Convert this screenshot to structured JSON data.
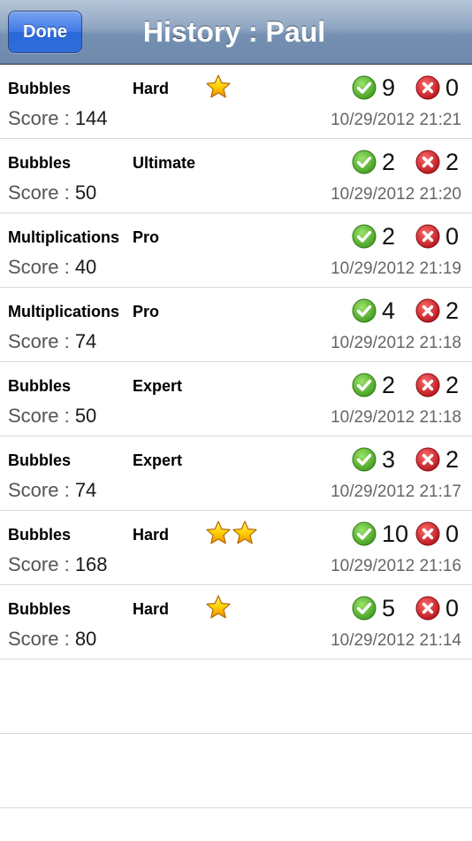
{
  "nav": {
    "done_label": "Done",
    "title": "History : Paul"
  },
  "score_prefix": "Score : ",
  "rows": [
    {
      "game": "Bubbles",
      "level": "Hard",
      "stars": 1,
      "score": "144",
      "correct": "9",
      "wrong": "0",
      "timestamp": "10/29/2012 21:21"
    },
    {
      "game": "Bubbles",
      "level": "Ultimate",
      "stars": 0,
      "score": "50",
      "correct": "2",
      "wrong": "2",
      "timestamp": "10/29/2012 21:20"
    },
    {
      "game": "Multiplications",
      "level": "Pro",
      "stars": 0,
      "score": "40",
      "correct": "2",
      "wrong": "0",
      "timestamp": "10/29/2012 21:19"
    },
    {
      "game": "Multiplications",
      "level": "Pro",
      "stars": 0,
      "score": "74",
      "correct": "4",
      "wrong": "2",
      "timestamp": "10/29/2012 21:18"
    },
    {
      "game": "Bubbles",
      "level": "Expert",
      "stars": 0,
      "score": "50",
      "correct": "2",
      "wrong": "2",
      "timestamp": "10/29/2012 21:18"
    },
    {
      "game": "Bubbles",
      "level": "Expert",
      "stars": 0,
      "score": "74",
      "correct": "3",
      "wrong": "2",
      "timestamp": "10/29/2012 21:17"
    },
    {
      "game": "Bubbles",
      "level": "Hard",
      "stars": 2,
      "score": "168",
      "correct": "10",
      "wrong": "0",
      "timestamp": "10/29/2012 21:16"
    },
    {
      "game": "Bubbles",
      "level": "Hard",
      "stars": 1,
      "score": "80",
      "correct": "5",
      "wrong": "0",
      "timestamp": "10/29/2012 21:14"
    }
  ],
  "empty_rows": 2,
  "icons": {
    "correct": "check-circle-icon",
    "wrong": "x-circle-icon",
    "star": "star-icon"
  },
  "colors": {
    "nav_bar": "#7590b2",
    "done_button": "#3f79e6",
    "correct": "#5cb531",
    "wrong": "#d8262c",
    "star": "#f5c400"
  }
}
